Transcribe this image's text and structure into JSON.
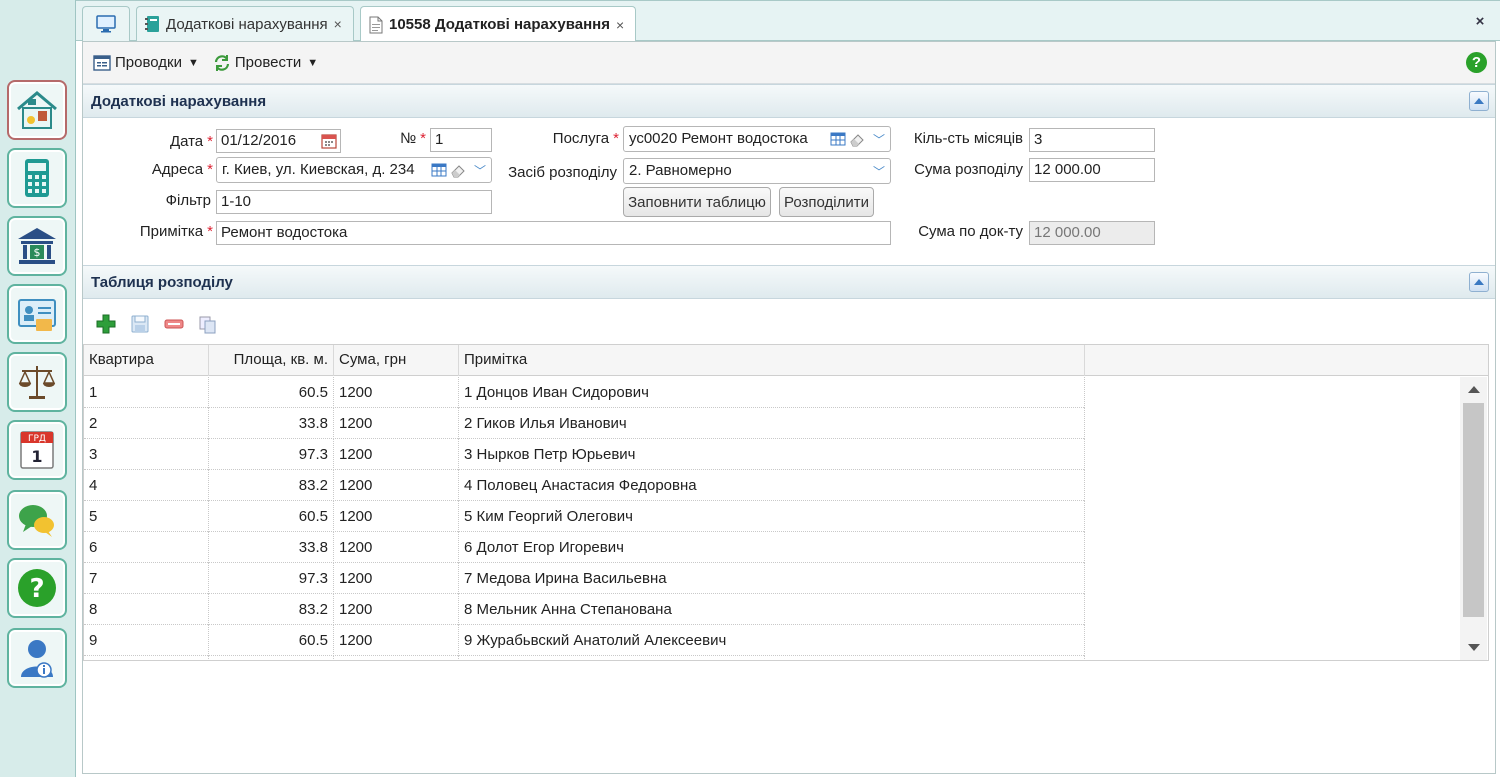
{
  "tabs": [
    {
      "label": ""
    },
    {
      "label": "Додаткові нарахування"
    },
    {
      "label": "10558 Додаткові нарахування"
    }
  ],
  "close_symbol": "×",
  "toolbar": {
    "postings_label": "Проводки",
    "post_label": "Провести",
    "help_glyph": "?"
  },
  "form_panel": {
    "title": "Додаткові нарахування",
    "date_label": "Дата",
    "date_value": "01/12/2016",
    "number_label": "№",
    "number_value": "1",
    "address_label": "Адреса",
    "address_value": "г. Киев, ул. Киевская, д. 234",
    "filter_label": "Фільтр",
    "filter_value": "1-10",
    "note_label": "Примітка",
    "note_value": "Ремонт водостока",
    "service_label": "Послуга",
    "service_value": "ус0020 Ремонт водостока",
    "distribution_label": "Засіб розподілу",
    "distribution_value": "2. Равномерно",
    "fill_table_label": "Заповнити таблицю",
    "distribute_label": "Розподілити",
    "months_label": "Кіль-сть місяців",
    "months_value": "3",
    "dist_sum_label": "Сума розподілу",
    "dist_sum_value": "12 000.00",
    "doc_sum_label": "Сума по док-ту",
    "doc_sum_value": "12 000.00",
    "required_mark": "*"
  },
  "table_panel": {
    "title": "Таблиця розподілу",
    "columns": [
      "Квартира",
      "Площа, кв. м.",
      "Сума, грн",
      "Примітка"
    ],
    "rows": [
      {
        "apt": "1",
        "area": "60.5",
        "sum": "1200",
        "note": "1 Донцов Иван Сидорович"
      },
      {
        "apt": "2",
        "area": "33.8",
        "sum": "1200",
        "note": "2 Гиков Илья Иванович"
      },
      {
        "apt": "3",
        "area": "97.3",
        "sum": "1200",
        "note": "3 Нырков Петр Юрьевич"
      },
      {
        "apt": "4",
        "area": "83.2",
        "sum": "1200",
        "note": "4 Половец Анастасия Федоровна"
      },
      {
        "apt": "5",
        "area": "60.5",
        "sum": "1200",
        "note": "5 Ким Георгий Олегович"
      },
      {
        "apt": "6",
        "area": "33.8",
        "sum": "1200",
        "note": "6 Долот Егор Игоревич"
      },
      {
        "apt": "7",
        "area": "97.3",
        "sum": "1200",
        "note": "7 Медова Ирина Васильевна"
      },
      {
        "apt": "8",
        "area": "83.2",
        "sum": "1200",
        "note": "8 Мельник Анна Степанована"
      },
      {
        "apt": "9",
        "area": "60.5",
        "sum": "1200",
        "note": "9 Журабьвский Анатолий Алексеевич"
      }
    ]
  },
  "sidebar": {
    "calendar_text": "ГРД",
    "calendar_day": "1",
    "help_glyph": "?"
  },
  "colors": {
    "accent_green": "#2aa12a",
    "header_text": "#1e3150",
    "required": "#d23"
  }
}
